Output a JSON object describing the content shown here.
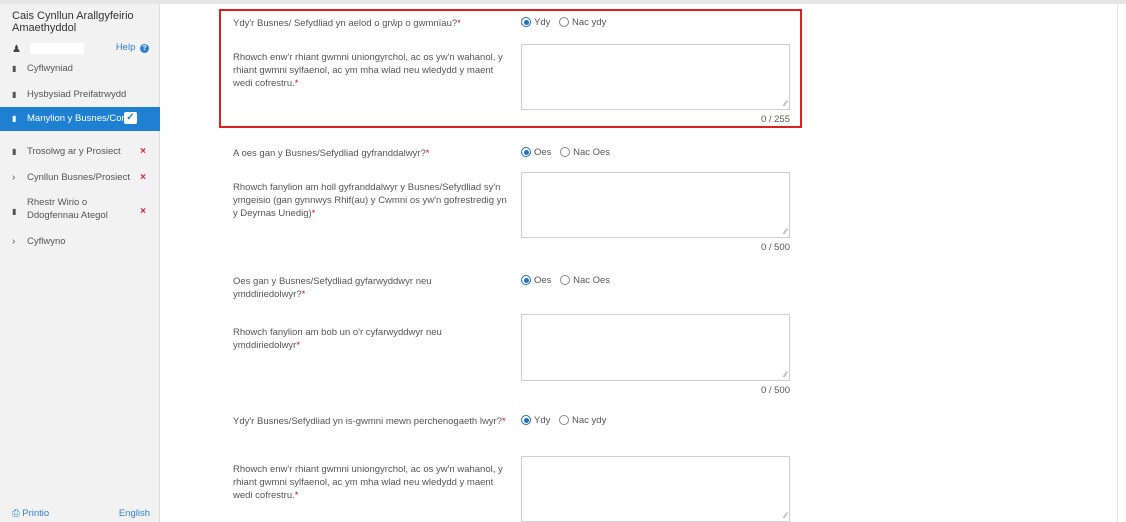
{
  "sidebar": {
    "title": "Cais Cynllun Arallgyfeirio Amaethyddol",
    "help_label": "Help",
    "items": [
      {
        "label": "Cyflwyniad",
        "icon": "document-icon",
        "status": ""
      },
      {
        "label": "Hysbysiad Preifatrwydd",
        "icon": "document-icon",
        "status": ""
      },
      {
        "label": "Manylion y Busnes/Corff",
        "icon": "document-icon",
        "status": "complete"
      },
      {
        "label": "Trosolwg ar y Prosiect",
        "icon": "document-icon",
        "status": "error"
      },
      {
        "label": "Cynllun Busnes/Prosiect",
        "icon": "chevron-right-icon",
        "status": "error"
      },
      {
        "label": "Rhestr Wirio o Ddogfennau Ategol",
        "icon": "document-icon",
        "status": "error"
      },
      {
        "label": "Cyflwyno",
        "icon": "chevron-right-icon",
        "status": ""
      }
    ],
    "print_label": "Printio",
    "language_label": "English"
  },
  "form": {
    "q1": {
      "label": "Ydy'r Busnes/ Sefydliad yn aelod o grŵp o gwmnïau?",
      "options": [
        "Ydy",
        "Nac ydy"
      ],
      "selected": "Ydy"
    },
    "q1_detail": {
      "label": "Rhowch enw'r rhiant gwmni uniongyrchol, ac os yw'n wahanol, y rhiant gwmni sylfaenol, ac ym mha wlad neu wledydd y maent wedi cofrestru.",
      "value": "",
      "counter": "0 / 255"
    },
    "q2": {
      "label": "A oes gan y Busnes/Sefydliad gyfranddalwyr?",
      "options": [
        "Oes",
        "Nac Oes"
      ],
      "selected": "Oes"
    },
    "q2_detail": {
      "label": "Rhowch fanylion am holl gyfranddalwyr y Busnes/Sefydliad sy'n ymgeisio (gan gynnwys Rhif(au) y Cwmni os yw'n gofrestredig yn y Deyrnas Unedig)",
      "value": "",
      "counter": "0 / 500"
    },
    "q3": {
      "label": "Oes gan y Busnes/Sefydliad gyfarwyddwyr neu ymddiriedolwyr?",
      "options": [
        "Oes",
        "Nac Oes"
      ],
      "selected": "Oes"
    },
    "q3_detail": {
      "label": "Rhowch fanylion am bob un o'r cyfarwyddwyr neu ymddiriedolwyr",
      "value": "",
      "counter": "0 / 500"
    },
    "q4": {
      "label": "Ydy'r Busnes/Sefydliad yn is-gwmni mewn perchenogaeth lwyr?",
      "options": [
        "Ydy",
        "Nac ydy"
      ],
      "selected": "Ydy"
    },
    "q4_detail": {
      "label": "Rhowch enw'r rhiant gwmni uniongyrchol, ac os yw'n wahanol, y rhiant gwmni sylfaenol, ac ym mha wlad neu wledydd y maent wedi cofrestru.",
      "value": ""
    },
    "required_marker": "*"
  },
  "colors": {
    "accent": "#1f7fd0",
    "highlight": "#e02020",
    "required": "#c8102e"
  }
}
